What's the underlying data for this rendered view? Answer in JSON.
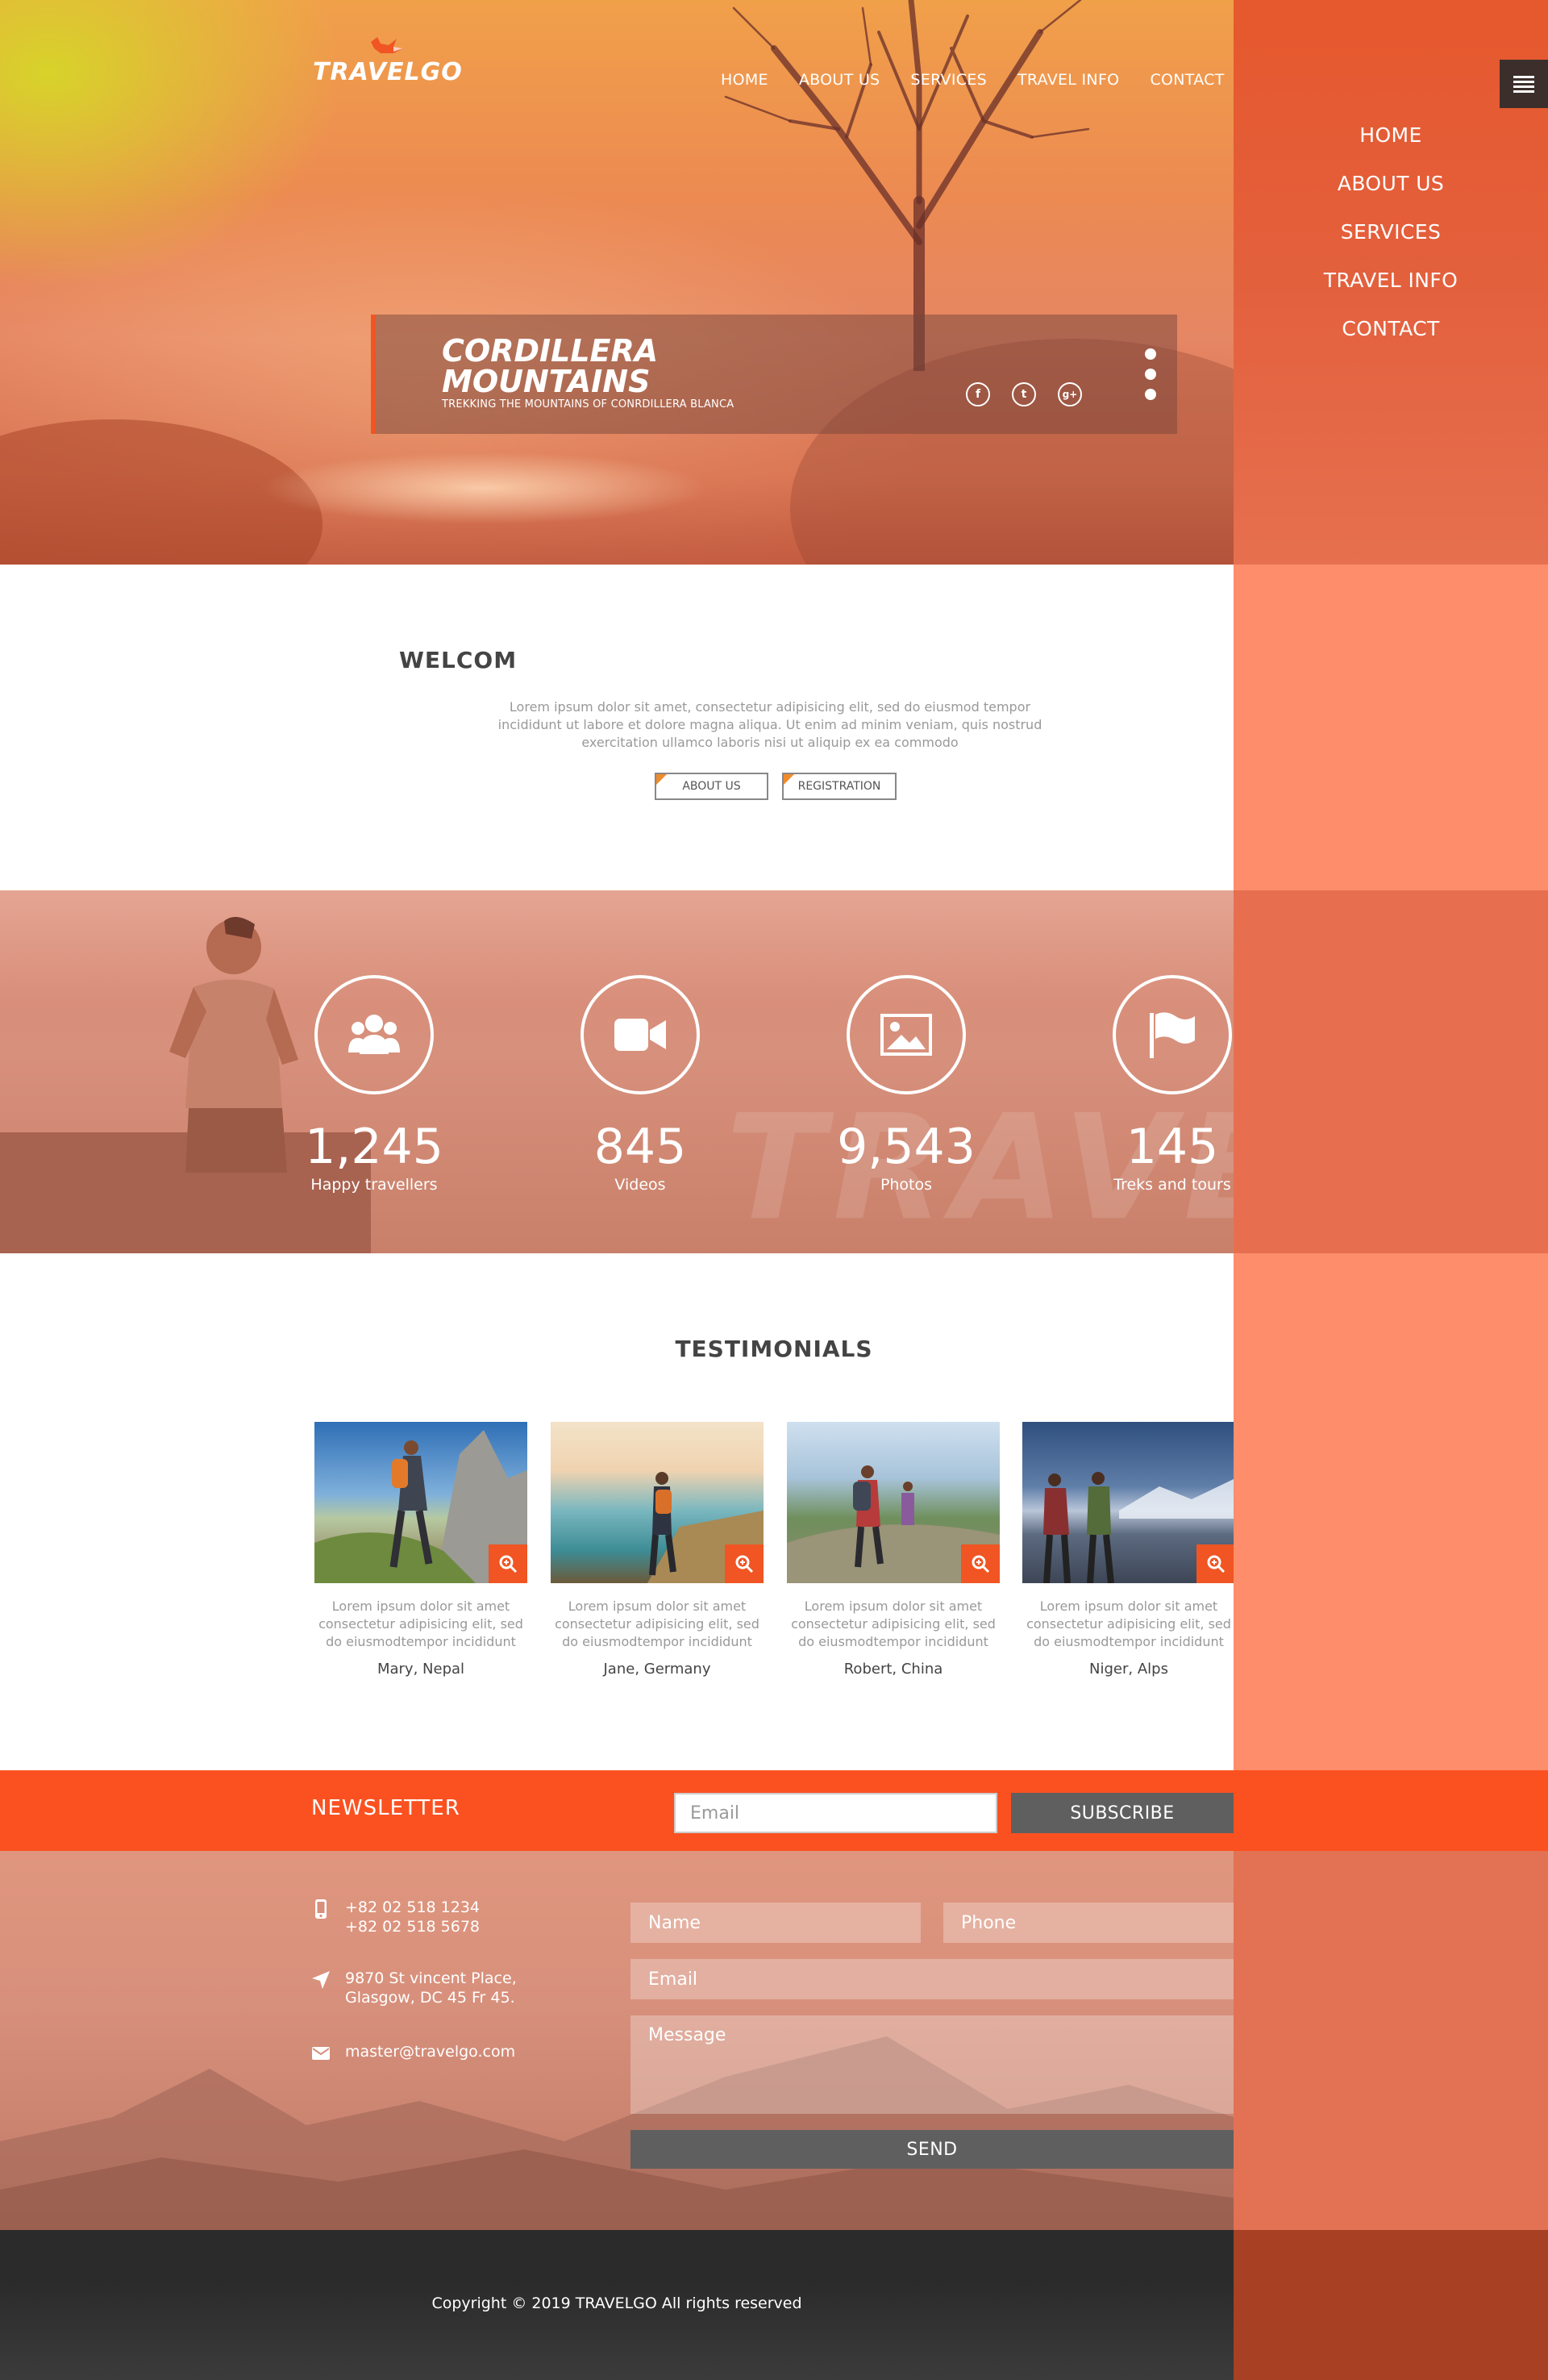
{
  "brand": {
    "name": "TRAVELGO"
  },
  "top_nav": [
    "HOME",
    "ABOUT US",
    "SERVICES",
    "TRAVEL INFO",
    "CONTACT"
  ],
  "side_menu": [
    "HOME",
    "ABOUT US",
    "SERVICES",
    "TRAVEL INFO",
    "CONTACT"
  ],
  "hero": {
    "title": "CORDILLERA MOUNTAINS",
    "subtitle": "TREKKING THE MOUNTAINS OF CONRDILLERA BLANCA",
    "social_icons": [
      "facebook-icon",
      "twitter-icon",
      "google-plus-icon"
    ],
    "slide_count": 3
  },
  "welcome": {
    "title": "WELCOM",
    "text": "Lorem ipsum dolor sit amet, consectetur adipisicing elit, sed do eiusmod tempor incididunt ut labore et dolore magna aliqua. Ut enim ad minim veniam, quis nostrud exercitation ullamco laboris nisi ut aliquip ex ea commodo",
    "buttons": [
      "ABOUT US",
      "REGISTRATION"
    ]
  },
  "stats": {
    "watermark": "TRAVELGO",
    "items": [
      {
        "icon": "users-icon",
        "value": "1,245",
        "label": "Happy travellers"
      },
      {
        "icon": "video-camera-icon",
        "value": "845",
        "label": "Videos"
      },
      {
        "icon": "image-icon",
        "value": "9,543",
        "label": "Photos"
      },
      {
        "icon": "flag-icon",
        "value": "145",
        "label": "Treks and tours"
      }
    ]
  },
  "testimonials": {
    "title": "TESTIMONIALS",
    "items": [
      {
        "text": "Lorem ipsum dolor sit amet consectetur adipisicing elit, sed do eiusmodtempor incididunt",
        "name": "Mary, Nepal"
      },
      {
        "text": "Lorem ipsum dolor sit amet consectetur adipisicing elit, sed do eiusmodtempor incididunt",
        "name": "Jane, Germany"
      },
      {
        "text": "Lorem ipsum dolor sit amet consectetur adipisicing elit, sed do eiusmodtempor incididunt",
        "name": "Robert, China"
      },
      {
        "text": "Lorem ipsum dolor sit amet consectetur adipisicing elit, sed do eiusmodtempor incididunt",
        "name": "Niger, Alps"
      }
    ]
  },
  "newsletter": {
    "title": "NEWSLETTER",
    "placeholder": "Email",
    "button": "SUBSCRIBE"
  },
  "contact": {
    "phone1": "+82 02 518 1234",
    "phone2": "+82 02 518 5678",
    "address1": "9870 St vincent Place,",
    "address2": "Glasgow, DC 45 Fr 45.",
    "email": "master@travelgo.com",
    "form": {
      "name": "Name",
      "phone": "Phone",
      "email": "Email",
      "message": "Message",
      "send": "SEND"
    }
  },
  "footer": {
    "copyright": "Copyright © 2019 TRAVELGO All rights reserved"
  },
  "colors": {
    "accent": "#fb5120",
    "panel": "#fe8d6c",
    "dark_button": "#5f5f5f",
    "footer": "#2b2b2b"
  }
}
